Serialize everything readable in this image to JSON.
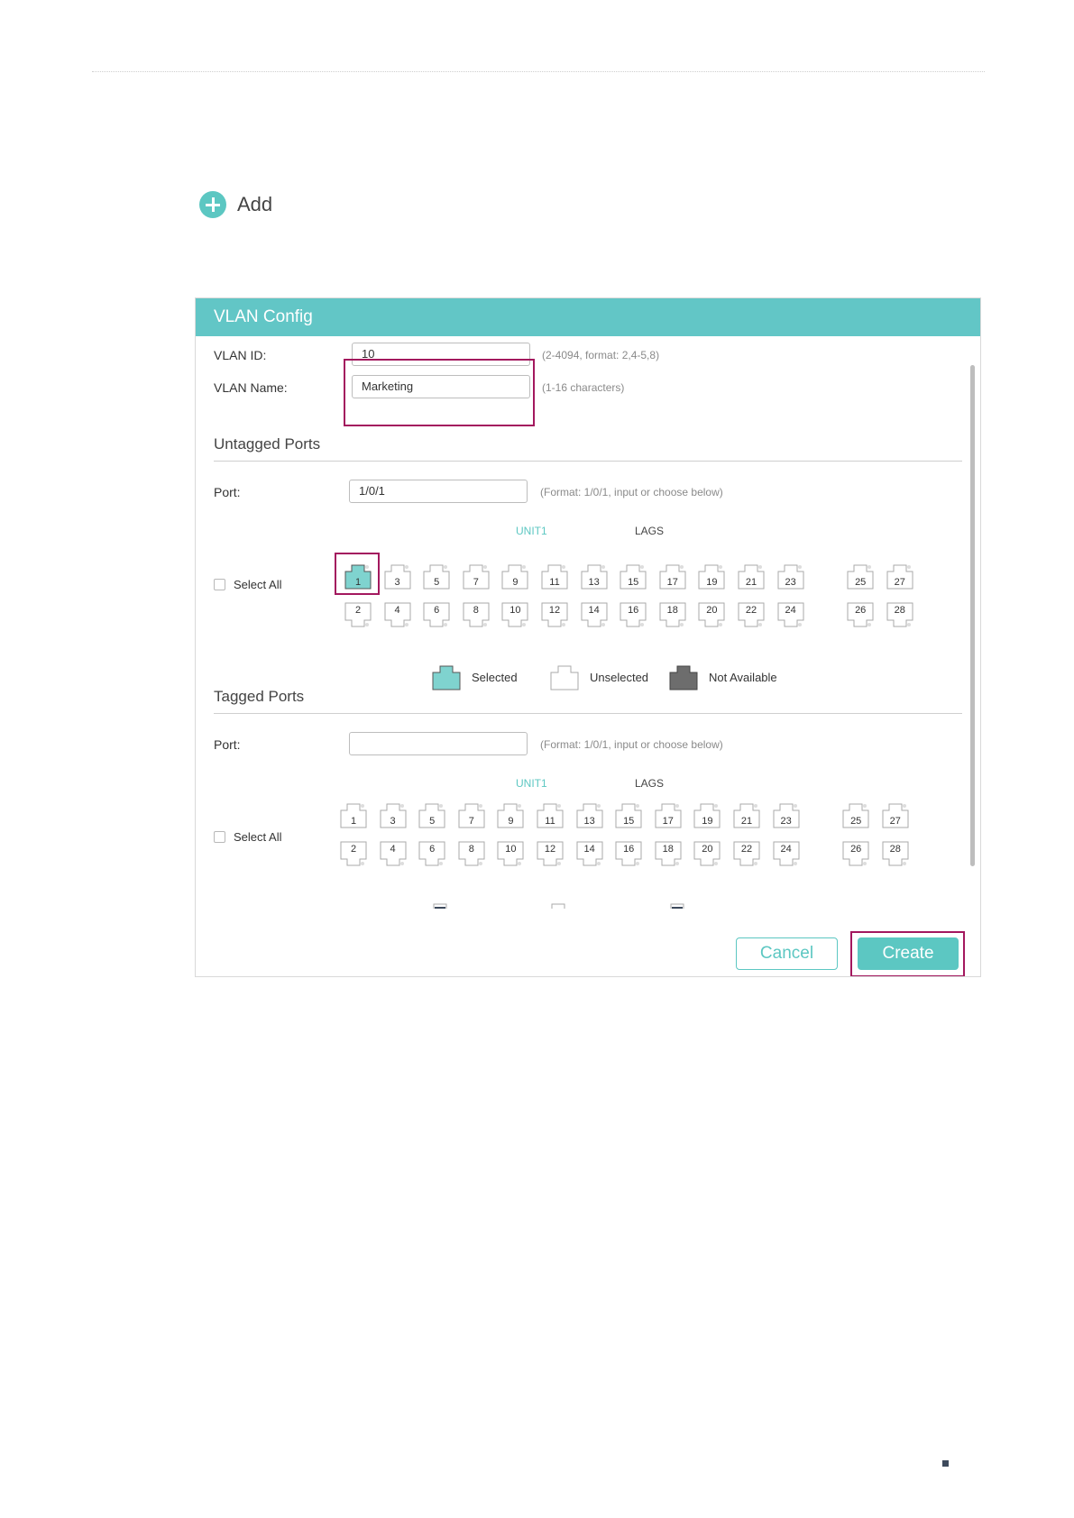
{
  "add": {
    "label": "Add",
    "icon": "plus-circle-icon"
  },
  "dialog": {
    "title": "VLAN Config",
    "vlan_id": {
      "label": "VLAN ID:",
      "value": "10",
      "hint": "(2-4094, format: 2,4-5,8)"
    },
    "vlan_name": {
      "label": "VLAN Name:",
      "value": "Marketing",
      "hint": "(1-16 characters)"
    },
    "untagged": {
      "title": "Untagged Ports",
      "port_label": "Port:",
      "port_value": "1/0/1",
      "port_hint": "(Format: 1/0/1, input or choose below)",
      "unit_label": "UNIT1",
      "lags_label": "LAGS",
      "select_all": "Select All",
      "selected_ports": [
        "1"
      ]
    },
    "tagged": {
      "title": "Tagged Ports",
      "port_label": "Port:",
      "port_value": "",
      "port_hint": "(Format: 1/0/1, input or choose below)",
      "unit_label": "UNIT1",
      "lags_label": "LAGS",
      "select_all": "Select All",
      "selected_ports": []
    },
    "ports_top": [
      "1",
      "3",
      "5",
      "7",
      "9",
      "11",
      "13",
      "15",
      "17",
      "19",
      "21",
      "23",
      "25",
      "27"
    ],
    "ports_bottom": [
      "2",
      "4",
      "6",
      "8",
      "10",
      "12",
      "14",
      "16",
      "18",
      "20",
      "22",
      "24",
      "26",
      "28"
    ],
    "legend": {
      "selected": "Selected",
      "unselected": "Unselected",
      "not_available": "Not Available"
    },
    "cancel_label": "Cancel",
    "create_label": "Create"
  },
  "colors": {
    "accent": "#5cc7c2",
    "highlight": "#a3185e",
    "not_available": "#6d6d6d"
  }
}
